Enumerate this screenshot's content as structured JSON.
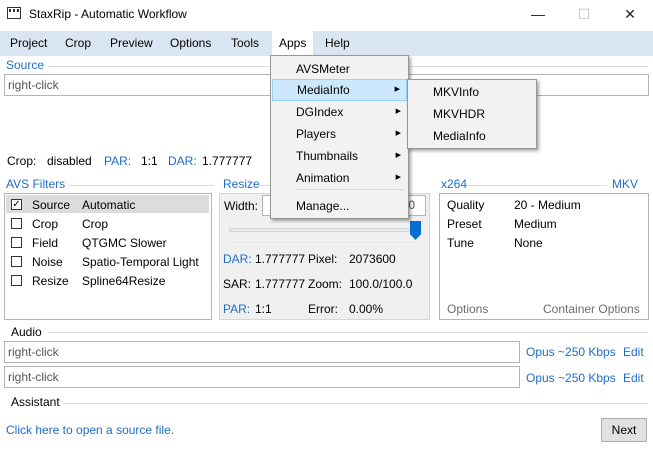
{
  "window": {
    "title": "StaxRip - Automatic Workflow",
    "minimize": "—",
    "maximize": "☐",
    "close": "✕"
  },
  "menubar": [
    "Project",
    "Crop",
    "Preview",
    "Options",
    "Tools",
    "Apps",
    "Help"
  ],
  "source": {
    "label": "Source",
    "placeholder": "right-click",
    "crop_label": "Crop:",
    "crop_value": "disabled",
    "par_label": "PAR:",
    "par_value": "1:1",
    "dar_label": "DAR:",
    "dar_value": "1.777777"
  },
  "filters": {
    "label": "AVS Filters",
    "rows": [
      {
        "name": "Source",
        "value": "Automatic",
        "checked": true,
        "selected": true
      },
      {
        "name": "Crop",
        "value": "Crop",
        "checked": false
      },
      {
        "name": "Field",
        "value": "QTGMC Slower",
        "checked": false
      },
      {
        "name": "Noise",
        "value": "Spatio-Temporal Light",
        "checked": false
      },
      {
        "name": "Resize",
        "value": "Spline64Resize",
        "checked": false
      }
    ]
  },
  "resize": {
    "label": "Resize",
    "width_label": "Width:",
    "width_value_tail": "0",
    "slider_level": 1.0,
    "dar_label": "DAR:",
    "dar_value": "1.777777",
    "pixel_label": "Pixel:",
    "pixel_value": "2073600",
    "sar_label": "SAR:",
    "sar_value": "1.777777",
    "zoom_label": "Zoom:",
    "zoom_value": "100.0/100.0",
    "par_label": "PAR:",
    "par_value": "1:1",
    "error_label": "Error:",
    "error_value": "0.00%"
  },
  "encoder": {
    "label": "x264",
    "container": "MKV",
    "rows": [
      {
        "name": "Quality",
        "value": "20 - Medium"
      },
      {
        "name": "Preset",
        "value": "Medium"
      },
      {
        "name": "Tune",
        "value": "None"
      }
    ],
    "options_label": "Options",
    "container_options_label": "Container Options"
  },
  "audio": {
    "label": "Audio",
    "tracks": [
      {
        "placeholder": "right-click",
        "profile": "Opus ~250 Kbps",
        "edit": "Edit"
      },
      {
        "placeholder": "right-click",
        "profile": "Opus ~250 Kbps",
        "edit": "Edit"
      }
    ]
  },
  "assistant": {
    "label": "Assistant",
    "message": "Click here to open a source file.",
    "next": "Next"
  },
  "apps_menu": {
    "items": [
      "AVSMeter",
      "MediaInfo",
      "DGIndex",
      "Players",
      "Thumbnails",
      "Animation",
      "Manage..."
    ],
    "submenu_items": [
      "MKVInfo",
      "MKVHDR",
      "MediaInfo"
    ]
  },
  "colors": {
    "accent": "#1e6dc8",
    "menubar": "#dae5f4",
    "highlight": "#cce8ff"
  }
}
